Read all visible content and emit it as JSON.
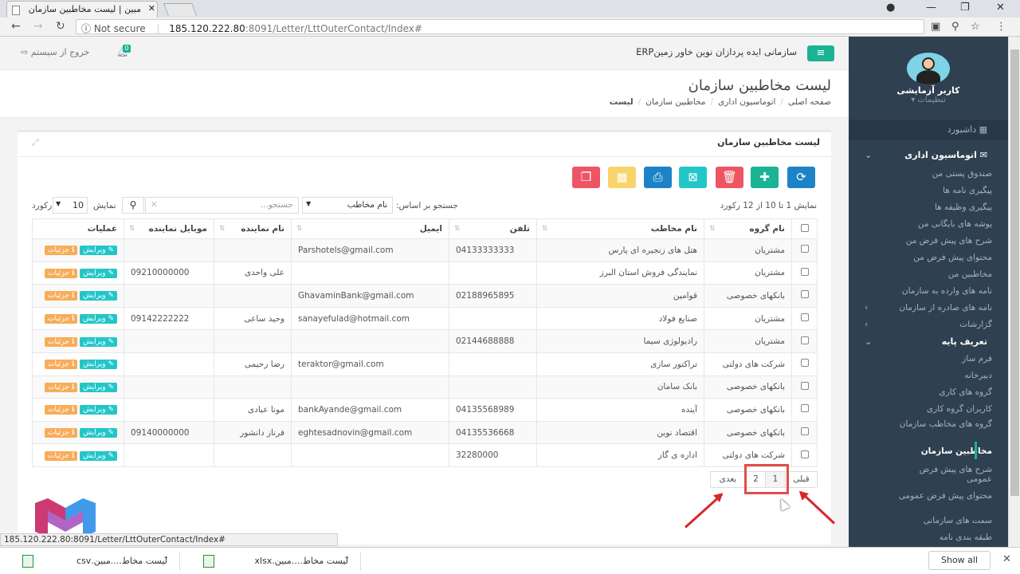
{
  "browser": {
    "tab_title": "مبین | لیست مخاطبین سازمان",
    "not_secure": "Not secure",
    "url_host": "185.120.222.80",
    "url_path": ":8091/Letter/LttOuterContact/Index#",
    "status_url": "185.120.222.80:8091/Letter/LttOuterContact/Index#"
  },
  "topbar": {
    "org_name": "سازمانی ایده پردازان نوین خاور زمینERP",
    "notification_count": "0",
    "logout": "خروج از سیستم"
  },
  "sidebar": {
    "user_name": "کاربر آزمایشی",
    "settings": "تنظیمات",
    "dashboard": "داشبورد",
    "section1": "اتوماسیون اداری",
    "items1": [
      "صندوق پستی من",
      "پیگیری نامه ها",
      "پیگیری وظیفه ها",
      "پوشه های بایگانی من",
      "شرح های پیش فرض من",
      "محتوای پیش فرض من",
      "مخاطبین من",
      "نامه های وارده به سازمان",
      "نامه های صادره از سازمان",
      "گزارشات"
    ],
    "section2": "تعریف پایه",
    "items2": [
      "فرم ساز",
      "دبیرخانه",
      "گروه های کاری",
      "کاربران گروه کاری",
      "گروه های مخاطب سازمان",
      "مخاطبین سازمان",
      "شرح های پیش فرض عمومی",
      "محتوای پیش فرض عمومی",
      "سمت های سازمانی",
      "طبقه بندی نامه"
    ]
  },
  "page": {
    "title": "لیست مخاطبین سازمان",
    "breadcrumb": [
      "صفحه اصلی",
      "اتوماسیون اداری",
      "مخاطبین سازمان",
      "لیست"
    ]
  },
  "panel": {
    "title": "لیست مخاطبین سازمان",
    "info": "نمایش 1 تا 10 از 12 رکورد",
    "search_by": "جستجو بر اساس:",
    "search_field": "نام مخاطب",
    "search_placeholder": "جستجو...",
    "show_label": "نمایش",
    "page_length": "10",
    "records_label": "رکورد"
  },
  "table": {
    "headers": [
      "نام گروه",
      "نام مخاطب",
      "تلفن",
      "ایمیل",
      "نام نماینده",
      "موبایل نماینده",
      "عملیات"
    ],
    "edit_label": "ویرایش",
    "detail_label": "جزئیات",
    "rows": [
      [
        "مشتریان",
        "هتل های زنجیره ای پارس",
        "04133333333",
        "Parshotels@gmail.com",
        "",
        ""
      ],
      [
        "مشتریان",
        "نمایندگی فروش استان البرز",
        "",
        "",
        "علی واحدی",
        "09210000000"
      ],
      [
        "بانکهای خصوصی",
        "قوامین",
        "02188965895",
        "GhavaminBank@gmail.com",
        "",
        ""
      ],
      [
        "مشتریان",
        "صنایع فولاد",
        "",
        "sanayefulad@hotmail.com",
        "وحید ساعی",
        "09142222222"
      ],
      [
        "مشتریان",
        "رادیولوژی سیما",
        "02144688888",
        "",
        "",
        ""
      ],
      [
        "شرکت های دولتی",
        "تراکتور سازی",
        "",
        "teraktor@gmail.com",
        "رضا رحیمی",
        ""
      ],
      [
        "بانکهای خصوصی",
        "بانک سامان",
        "",
        "",
        "",
        ""
      ],
      [
        "بانکهای خصوصی",
        "آینده",
        "04135568989",
        "bankAyande@gmail.com",
        "مونا عبادی",
        ""
      ],
      [
        "بانکهای خصوصی",
        "اقتصاد نوین",
        "04135536668",
        "eghtesadnovin@gmail.com",
        "فرناز دانشور",
        "09140000000"
      ],
      [
        "شرکت های دولتی",
        "اداره ی گاز",
        "32280000",
        "",
        "",
        ""
      ]
    ]
  },
  "pagination": {
    "prev": "قبلی",
    "page1": "1",
    "page2": "2",
    "next": "بعدی"
  },
  "downloads": {
    "items": [
      "لیست مخاط....مبین.csv",
      "لیست مخاط....مبین.xlsx"
    ],
    "show_all": "Show all"
  },
  "colors": {
    "accent": "#1ab394",
    "sidebar": "#2f4050",
    "annotation": "#d9262b"
  }
}
